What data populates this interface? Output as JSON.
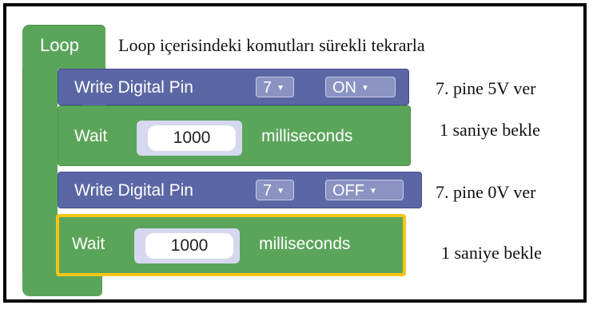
{
  "loop": {
    "label": "Loop",
    "comment": "Loop içerisindeki komutları sürekli tekrarla"
  },
  "blocks": [
    {
      "type": "write",
      "label": "Write Digital Pin",
      "pin": "7",
      "state": "ON",
      "comment": "7. pine 5V ver"
    },
    {
      "type": "wait",
      "label": "Wait",
      "value": "1000",
      "unit": "milliseconds",
      "comment": "1 saniye bekle"
    },
    {
      "type": "write",
      "label": "Write Digital Pin",
      "pin": "7",
      "state": "OFF",
      "comment": "7. pine 0V ver"
    },
    {
      "type": "wait",
      "label": "Wait",
      "value": "1000",
      "unit": "milliseconds",
      "comment": "1 saniye bekle",
      "selected": true
    }
  ],
  "colors": {
    "loop_green": "#5ba55b",
    "write_blue": "#5b67a5",
    "selection_yellow": "#f5c518"
  },
  "icons": {
    "dropdown": "triangle-down"
  }
}
